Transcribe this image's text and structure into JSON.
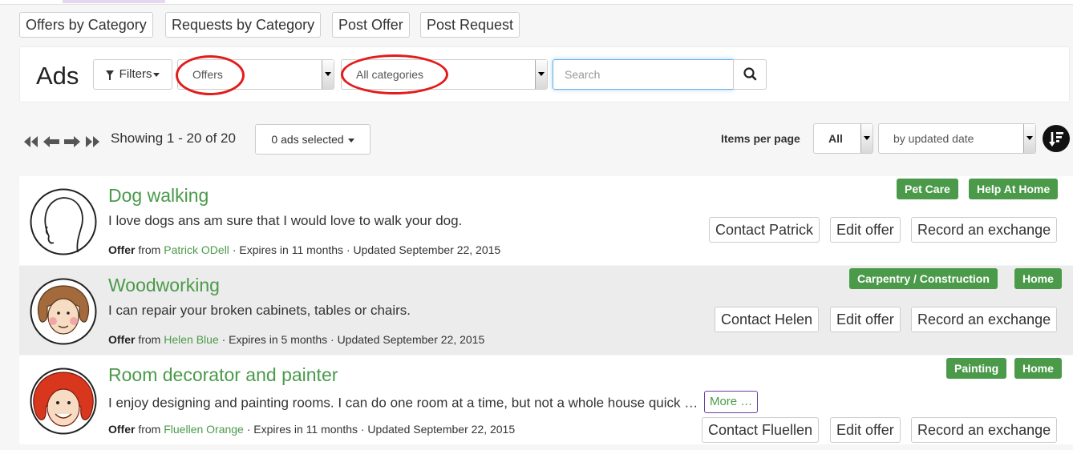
{
  "nav": {
    "tabs": [
      {
        "label": "Offers by Category"
      },
      {
        "label": "Requests by Category"
      },
      {
        "label": "Post Offer"
      },
      {
        "label": "Post Request"
      }
    ]
  },
  "ads_panel": {
    "title": "Ads",
    "filters_label": "Filters",
    "type_select_value": "Offers",
    "category_select_value": "All categories",
    "search_placeholder": "Search",
    "highlight_color": "#e31b1b"
  },
  "listing": {
    "showing_text": "Showing 1 - 20 of 20",
    "selected_label": "0 ads selected",
    "items_per_page_label": "Items per page",
    "items_per_page_value": "All",
    "sort_value": "by updated date"
  },
  "ads": [
    {
      "title": "Dog walking",
      "description": "I love dogs ans am sure that I would love to walk your dog.",
      "kind": "Offer",
      "from_word": "from",
      "author": "Patrick ODell",
      "expires": "· Expires in 11 months · Updated September 22, 2015",
      "tags": [
        "Pet Care",
        "Help At Home"
      ],
      "contact_label": "Contact Patrick",
      "edit_label": "Edit offer",
      "record_label": "Record an exchange"
    },
    {
      "title": "Woodworking",
      "description": "I can repair your broken cabinets, tables or chairs.",
      "kind": "Offer",
      "from_word": "from",
      "author": "Helen Blue",
      "expires": "· Expires in 5 months · Updated September 22, 2015",
      "tags": [
        "Carpentry / Construction",
        "Home"
      ],
      "contact_label": "Contact Helen",
      "edit_label": "Edit offer",
      "record_label": "Record an exchange"
    },
    {
      "title": "Room decorator and painter",
      "description": "I enjoy designing and painting rooms.  I can do one room at a time, but not a whole house quick …",
      "more_label": "More …",
      "kind": "Offer",
      "from_word": "from",
      "author": "Fluellen Orange",
      "expires": "· Expires in 11 months · Updated September 22, 2015",
      "tags": [
        "Painting",
        "Home"
      ],
      "contact_label": "Contact Fluellen",
      "edit_label": "Edit offer",
      "record_label": "Record an exchange"
    }
  ],
  "theme": {
    "accent_green": "#4a9a4a",
    "focus_blue": "#66afe9",
    "alt_row_bg": "#ececec"
  }
}
